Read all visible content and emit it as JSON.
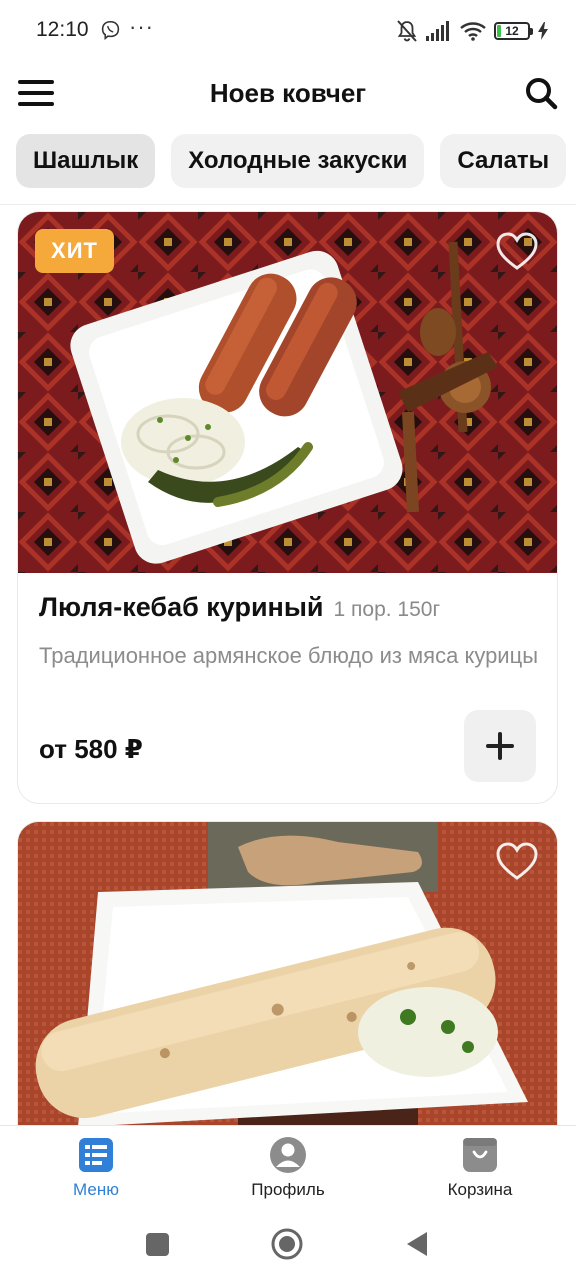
{
  "status_bar": {
    "time": "12:10",
    "dots": "···",
    "battery": "12"
  },
  "header": {
    "title": "Ноев ковчег",
    "menu_icon": "hamburger-icon",
    "search_icon": "search-icon"
  },
  "categories": [
    {
      "label": "Шашлык",
      "active": true
    },
    {
      "label": "Холодные закуски",
      "active": false
    },
    {
      "label": "Салаты",
      "active": false
    }
  ],
  "products": [
    {
      "badge": "ХИТ",
      "name": "Люля-кебаб куриный",
      "portion": "1 пор. 150г",
      "description": "Традиционное армянское блюдо из мяса курицы",
      "price": "от 580 ₽"
    },
    {
      "badge": "",
      "name": "",
      "portion": "",
      "description": "",
      "price": ""
    }
  ],
  "bottom_nav": {
    "items": [
      {
        "label": "Меню",
        "icon": "menu-list-icon",
        "active": true
      },
      {
        "label": "Профиль",
        "icon": "profile-icon",
        "active": false
      },
      {
        "label": "Корзина",
        "icon": "cart-icon",
        "active": false
      }
    ]
  },
  "colors": {
    "accent": "#2f80d6",
    "badge": "#f6a93b",
    "chip_bg": "#f1f1f1"
  }
}
